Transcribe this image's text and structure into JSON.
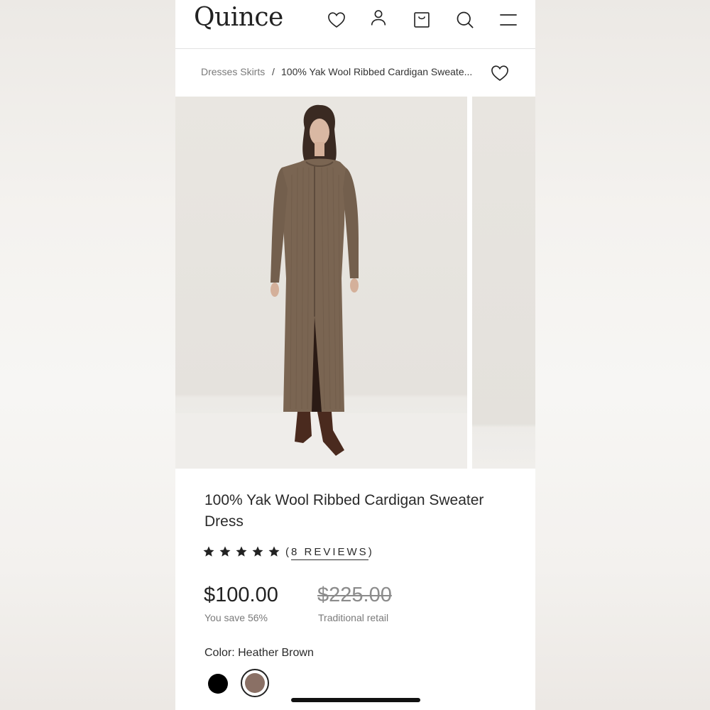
{
  "header": {
    "logo": "Quince",
    "icons": [
      "heart-icon",
      "user-icon",
      "bag-icon",
      "search-icon",
      "menu-icon"
    ]
  },
  "breadcrumb": {
    "parent": "Dresses Skirts",
    "separator": "/",
    "current": "100% Yak Wool Ribbed Cardigan Sweate..."
  },
  "product": {
    "title": "100% Yak Wool Ribbed Cardigan Sweater Dress",
    "rating_stars": 5,
    "reviews_open": "(",
    "reviews_link": "8 REVIEWS",
    "reviews_close": ")",
    "price": "$100.00",
    "savings": "You save 56%",
    "retail_price": "$225.00",
    "retail_label": "Traditional retail",
    "color_label": "Color:",
    "color_value": "Heather Brown",
    "swatches": [
      {
        "name": "black",
        "color": "#000000"
      },
      {
        "name": "heather-brown",
        "color": "#8a7065",
        "selected": true
      }
    ]
  },
  "colors": {
    "dress": "#7a6552",
    "boots": "#4a2a1e",
    "background": "#e7e4df"
  }
}
